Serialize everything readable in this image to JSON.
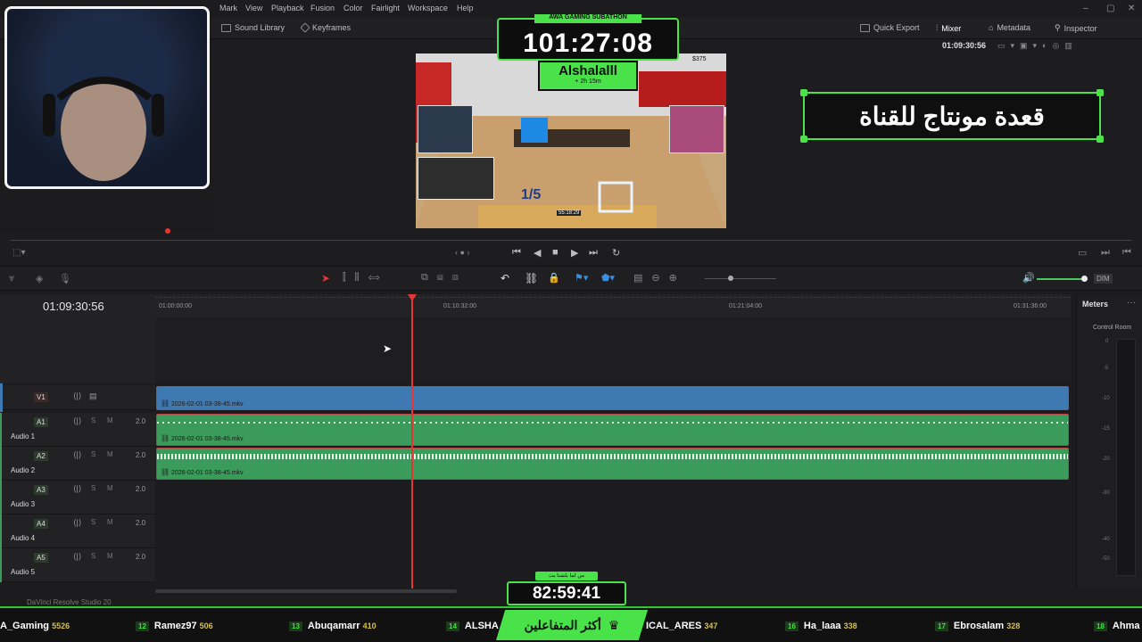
{
  "menu": [
    "Mark",
    "View",
    "Playback",
    "Fusion",
    "Color",
    "Fairlight",
    "Workspace",
    "Help"
  ],
  "toolbar": {
    "sound_library": "Sound Library",
    "keyframes": "Keyframes",
    "quick_export": "Quick Export",
    "mixer": "Mixer",
    "metadata": "Metadata",
    "inspector": "Inspector",
    "timecode": "01:09:30:56"
  },
  "overlay": {
    "subathon_title": "AWA GAMING SUBATHON",
    "subathon_time": "101:27:08",
    "streamer_name": "Alshalalll",
    "added_time": "+ 2h 15m",
    "banner_text": "قعدة مونتاج للقناة"
  },
  "video_hud": {
    "money": "$375",
    "counter": "1/5",
    "clock": "55:18:29"
  },
  "timeline": {
    "current_timecode": "01:09:30:56",
    "ruler_marks": [
      "01:00:00:00",
      "01:10:32:00",
      "01:21:04:00",
      "01:31:36:00"
    ],
    "meters_label": "Meters",
    "control_room": "Control Room",
    "meter_scale": [
      "0",
      "-5",
      "-10",
      "-15",
      "-20",
      "-30",
      "-40",
      "-50"
    ],
    "tracks": [
      {
        "id": "V1",
        "name": "",
        "volume": "",
        "clip": "2026-02-01 03-38-45.mkv"
      },
      {
        "id": "A1",
        "name": "Audio 1",
        "volume": "2.0",
        "clip": "2026-02-01 03-38-45.mkv"
      },
      {
        "id": "A2",
        "name": "Audio 2",
        "volume": "2.0",
        "clip": "2026-02-01 03-38-45.mkv"
      },
      {
        "id": "A3",
        "name": "Audio 3",
        "volume": "2.0",
        "clip": ""
      },
      {
        "id": "A4",
        "name": "Audio 4",
        "volume": "2.0",
        "clip": ""
      },
      {
        "id": "A5",
        "name": "Audio 5",
        "volume": "2.0",
        "clip": ""
      }
    ],
    "dim_label": "DIM"
  },
  "bottom_timer": {
    "label": "من لما بلشنا بث",
    "time": "82:59:41"
  },
  "app_name": "DaVinci Resolve Studio 20",
  "ticker": {
    "center_label": "أكثر المتفاعلين",
    "entries": [
      {
        "rank": "",
        "name": "A_Gaming",
        "points": "5526"
      },
      {
        "rank": "12",
        "name": "Ramez97",
        "points": "506"
      },
      {
        "rank": "13",
        "name": "Abuqamarr",
        "points": "410"
      },
      {
        "rank": "14",
        "name": "ALSHA",
        "points": ""
      },
      {
        "rank": "",
        "name": "ICAL_ARES",
        "points": "347"
      },
      {
        "rank": "16",
        "name": "Ha_laaa",
        "points": "338"
      },
      {
        "rank": "17",
        "name": "Ebrosalam",
        "points": "328"
      },
      {
        "rank": "18",
        "name": "Ahma",
        "points": ""
      }
    ]
  },
  "colors": {
    "green": "#49e349",
    "video_clip": "#3f79b1",
    "audio_clip": "#3b9b5a",
    "playhead": "#e53535"
  }
}
